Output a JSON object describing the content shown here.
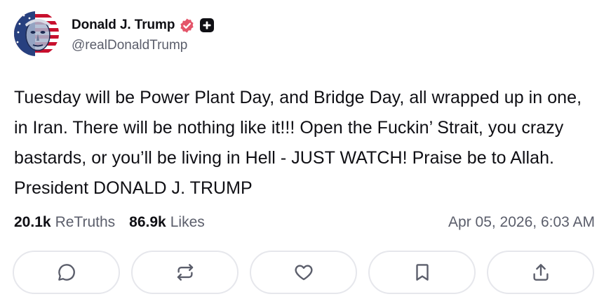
{
  "author": {
    "display_name": "Donald J. Trump",
    "handle": "@realDonaldTrump",
    "avatar": "avatar-image",
    "verified_icon": "verified-badge-icon",
    "extra_badge_icon": "plus-badge-icon"
  },
  "post": {
    "text": "Tuesday will be Power Plant Day, and Bridge Day, all wrapped up in one, in Iran. There will be nothing like it!!! Open the Fuckin’ Strait, you crazy bastards, or you’ll be living in Hell - JUST WATCH! Praise be to Allah. President DONALD J. TRUMP"
  },
  "stats": {
    "retruths_count": "20.1k",
    "retruths_label": "ReTruths",
    "likes_count": "86.9k",
    "likes_label": "Likes",
    "timestamp": "Apr 05, 2026, 6:03 AM"
  },
  "actions": [
    {
      "name": "reply",
      "icon": "comment-icon"
    },
    {
      "name": "retruth",
      "icon": "repost-icon"
    },
    {
      "name": "like",
      "icon": "heart-icon"
    },
    {
      "name": "bookmark",
      "icon": "bookmark-icon"
    },
    {
      "name": "share",
      "icon": "share-icon"
    }
  ],
  "colors": {
    "text": "#0f0f14",
    "muted": "#5b5e6b",
    "border": "#e6e7ec",
    "verified": "#e4556a"
  }
}
